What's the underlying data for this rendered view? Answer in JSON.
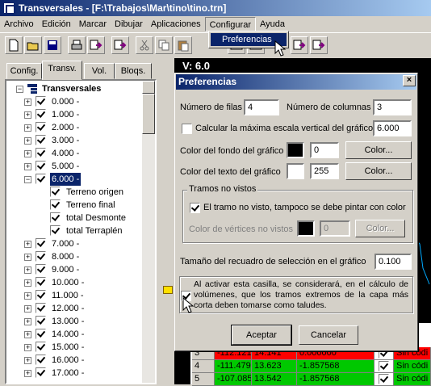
{
  "window": {
    "title": "Transversales - [F:\\Trabajos\\Mar\\tino\\tino.trn]"
  },
  "menu": [
    "Archivo",
    "Edición",
    "Marcar",
    "Dibujar",
    "Aplicaciones",
    "Configurar",
    "Ayuda"
  ],
  "dropdown": {
    "item": "Preferencias"
  },
  "tabs": [
    "Config.",
    "Transv.",
    "Vol.",
    "Bloqs."
  ],
  "tree": {
    "root": "Transversales",
    "items_before": [
      "0.000 -",
      "1.000 -",
      "2.000 -",
      "3.000 -",
      "4.000 -",
      "5.000 -"
    ],
    "expanded": "6.000 -",
    "children": [
      "Terreno origen",
      "Terreno final",
      "total Desmonte",
      "total Terraplén"
    ],
    "items_after": [
      "7.000 -",
      "8.000 -",
      "9.000 -",
      "10.000 -",
      "11.000 -",
      "12.000 -",
      "13.000 -",
      "14.000 -",
      "15.000 -",
      "16.000 -",
      "17.000 -"
    ]
  },
  "background": {
    "header": "V: 6.0"
  },
  "grid": {
    "rows": [
      {
        "n": "4",
        "a": "-111.479",
        "b": "13.623",
        "c": "-1.857568",
        "d": "Sin códi"
      },
      {
        "n": "5",
        "a": "-107.085",
        "b": "13.542",
        "c": "-1.857568",
        "d": "Sin códi"
      }
    ],
    "partial": [
      "3",
      "-112.121",
      "14.141",
      "0.000000",
      "Sin códi"
    ]
  },
  "dialog": {
    "title": "Preferencias",
    "rows_label": "Número de filas",
    "rows_value": "4",
    "cols_label": "Número de columnas",
    "cols_value": "3",
    "calc_label": "Calcular la máxima escala vertical  del gráfico",
    "calc_value": "6.000",
    "bg_label": "Color del fondo del gráfico",
    "bg_value": "0",
    "bg_button": "Color...",
    "text_label": "Color del texto del gráfico",
    "text_value": "255",
    "text_button": "Color...",
    "group_label": "Tramos no vistos",
    "group_check_label": "El tramo no visto, tampoco se debe pintar con color",
    "vertex_label": "Color de vértices no vistos",
    "vertex_value": "0",
    "vertex_button": "Color...",
    "box_label": "Tamaño del recuadro de selección en el gráfico",
    "box_value": "0.100",
    "volumes_text": "Al activar esta casilla, se considerará, en el cálculo de volúmenes, que los tramos extremos de la capa más corta deben tomarse como taludes.",
    "accept": "Aceptar",
    "cancel": "Cancelar"
  },
  "colors": {
    "titlebar": "#0a246a",
    "selection": "#0a246a",
    "face": "#d4d0c8",
    "green": "#00c800",
    "red": "#ff0000"
  }
}
